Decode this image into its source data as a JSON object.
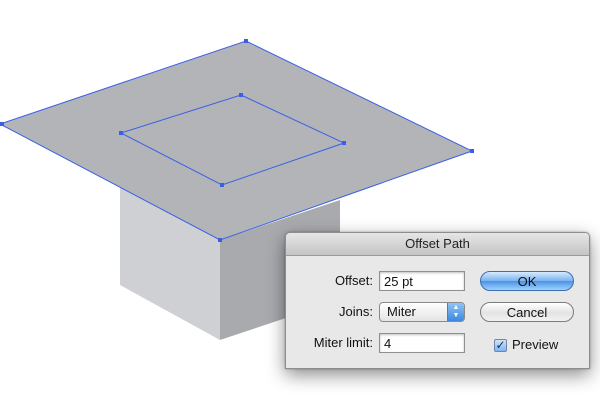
{
  "dialog": {
    "title": "Offset Path",
    "offset_label": "Offset:",
    "offset_value": "25 pt",
    "joins_label": "Joins:",
    "joins_value": "Miter",
    "miter_label": "Miter limit:",
    "miter_value": "4",
    "ok_label": "OK",
    "cancel_label": "Cancel",
    "preview_label": "Preview",
    "preview_checked": true
  },
  "colors": {
    "selection": "#3a5fe6",
    "top_face": "#b3b4b8",
    "left_face": "#cfd0d4",
    "right_face": "#a9aaae"
  }
}
